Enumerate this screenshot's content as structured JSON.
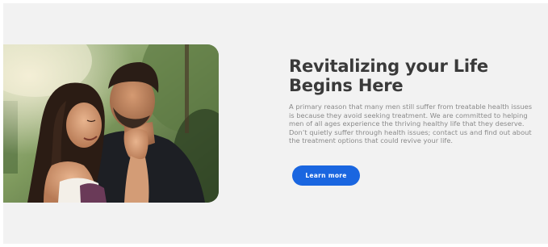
{
  "hero": {
    "title": "Revitalizing your Life Begins Here",
    "body": "A primary reason that many men still suffer from treatable health issues is because they avoid seeking treatment. We are committed to helping men of all ages experience the thriving healthy life that they deserve. Don’t quietly suffer through health issues; contact us and find out about the treatment options that could revive your  life.",
    "cta_label": "Learn more",
    "image_alt": "couple-embrace-photo"
  },
  "colors": {
    "background": "#f2f2f2",
    "title": "#3a3a3a",
    "body": "#8a8a8a",
    "button": "#1a66e0",
    "button_text": "#ffffff"
  }
}
